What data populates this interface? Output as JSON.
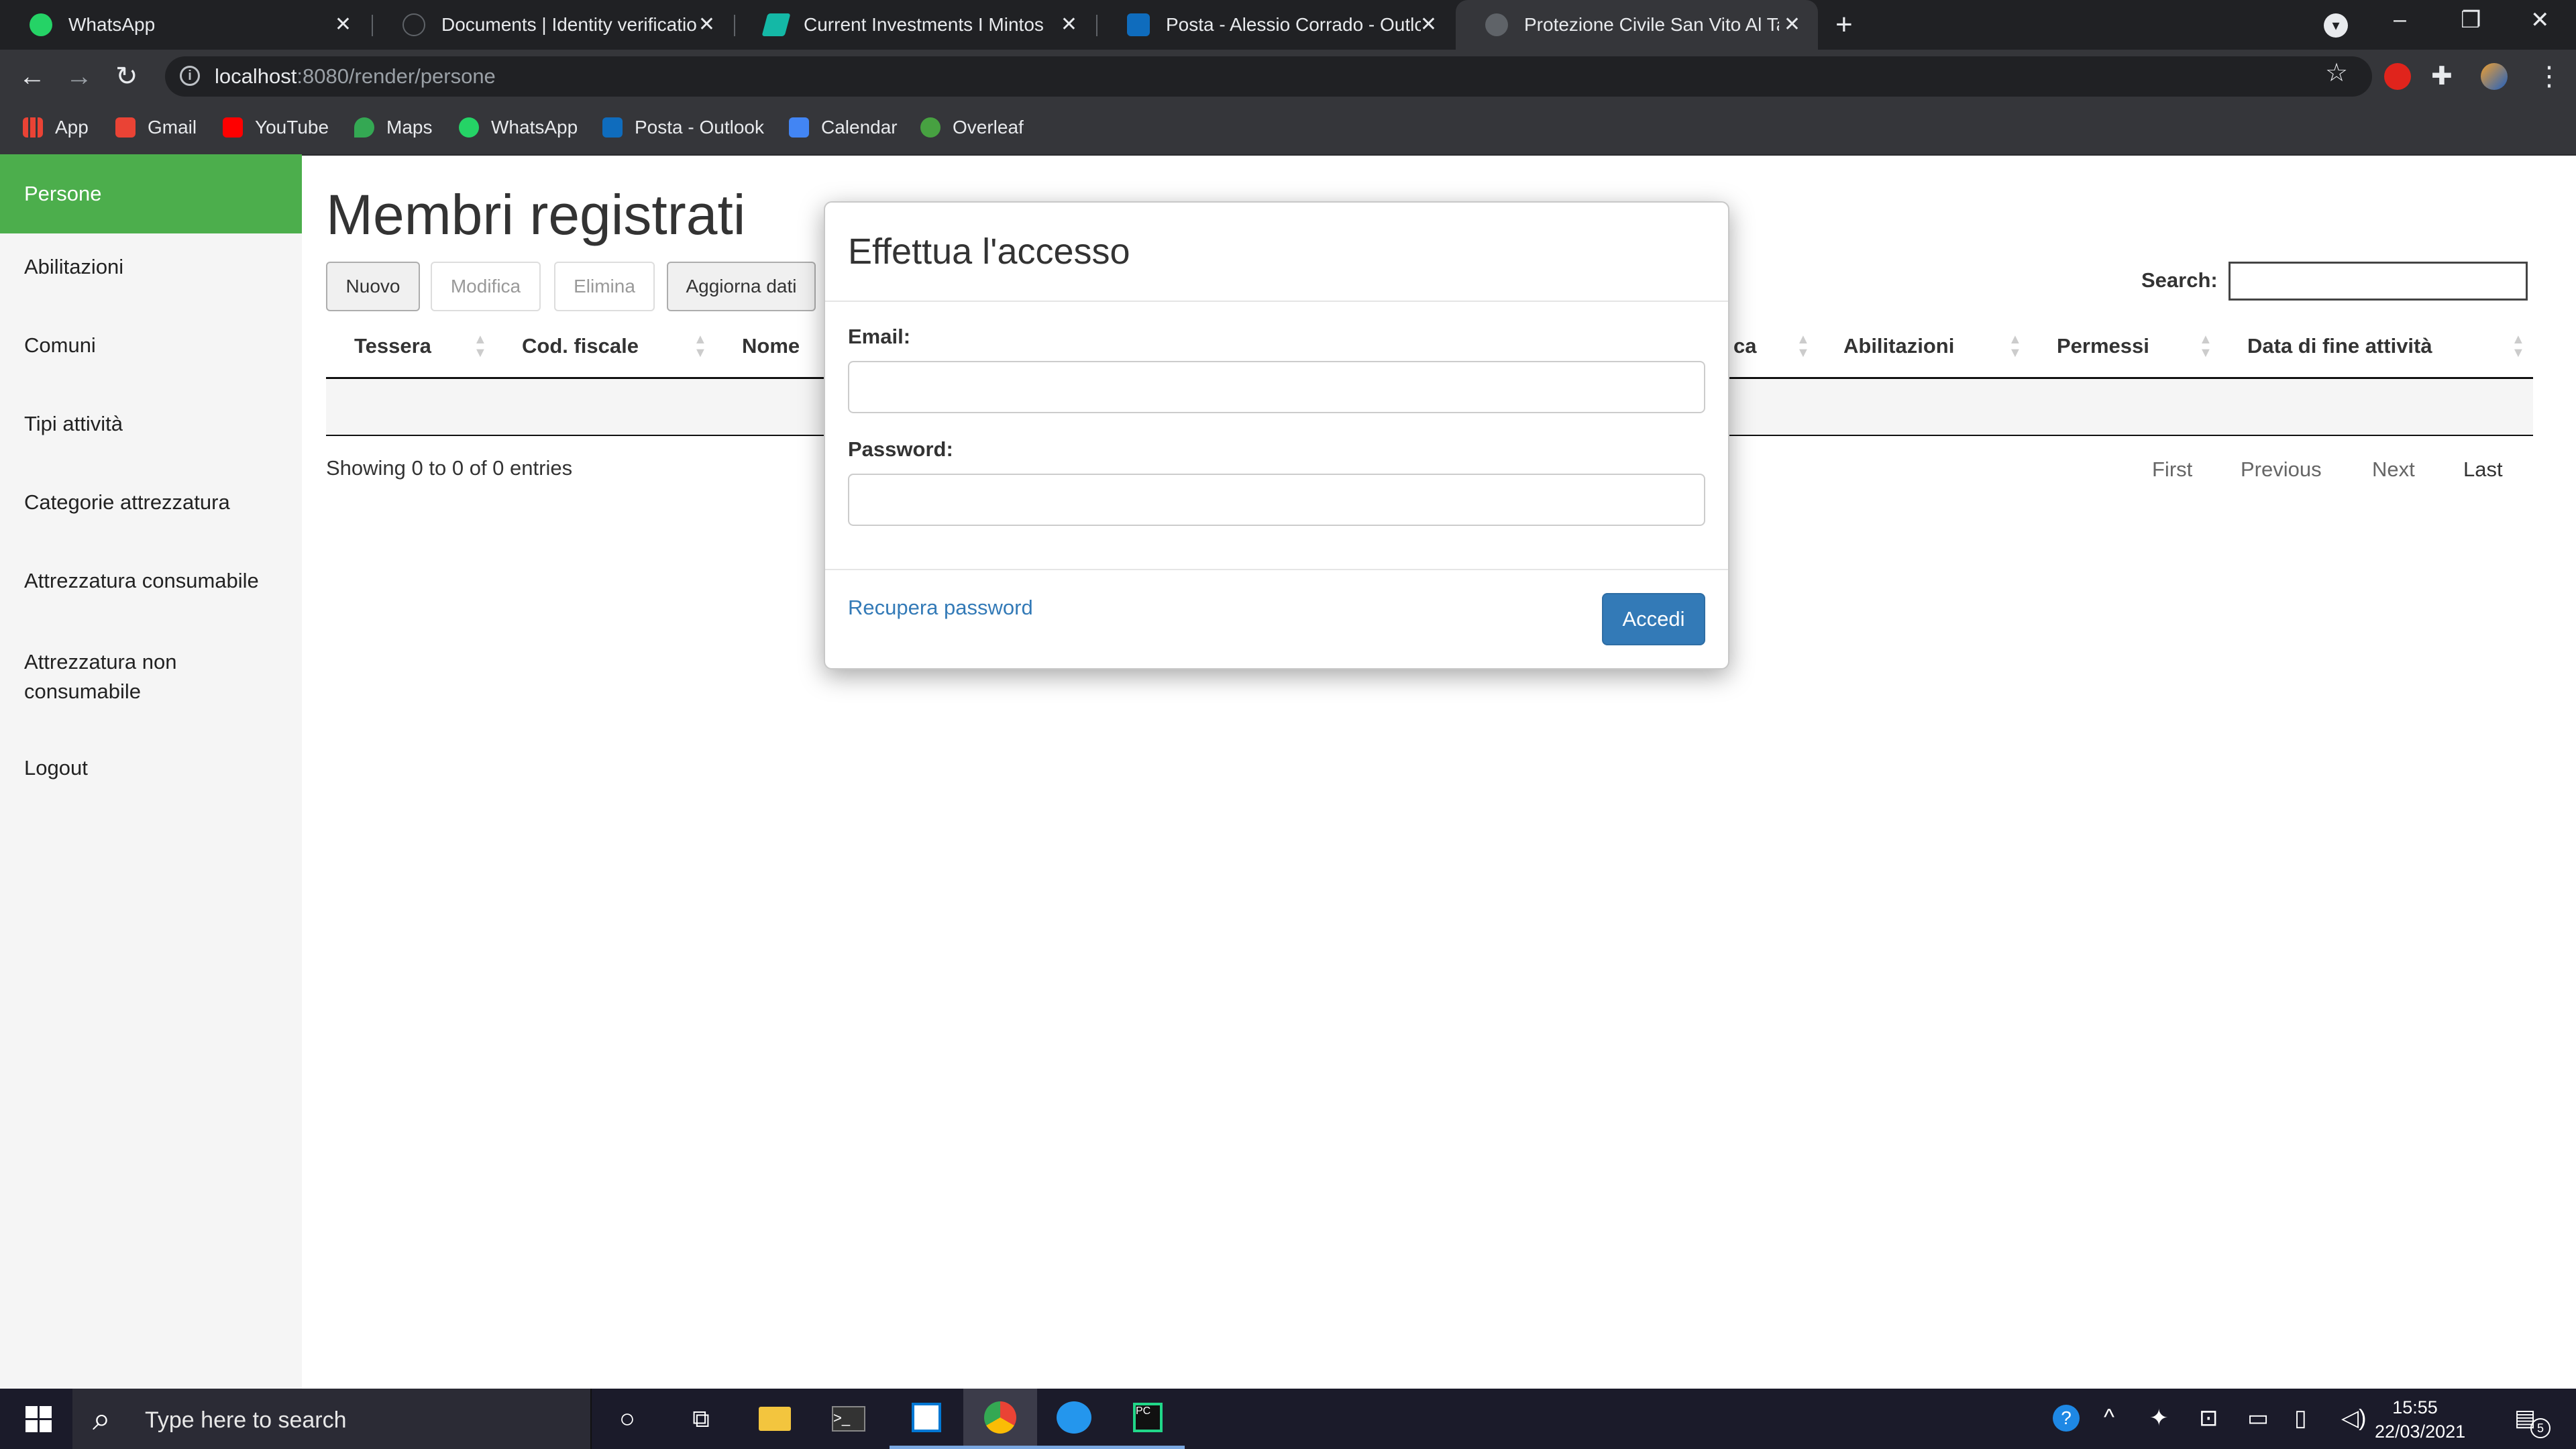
{
  "browser": {
    "tabs": [
      {
        "title": "WhatsApp",
        "icon": "whatsapp-icon",
        "color": "#25d366"
      },
      {
        "title": "Documents | Identity verification",
        "icon": "identity-site-icon",
        "color": "#5f6368"
      },
      {
        "title": "Current Investments I Mintos",
        "icon": "mintos-icon",
        "color": "#14b8a6"
      },
      {
        "title": "Posta - Alessio Corrado - Outlook",
        "icon": "outlook-icon",
        "color": "#0f6cbd"
      },
      {
        "title": "Protezione Civile San Vito Al Tagliamento",
        "icon": "globe-icon",
        "color": "#5f6368"
      }
    ],
    "url_host": "localhost",
    "url_rest": ":8080/render/persone",
    "bookmarks": [
      {
        "label": "App",
        "icon": "apps-grid-icon"
      },
      {
        "label": "Gmail",
        "icon": "gmail-icon"
      },
      {
        "label": "YouTube",
        "icon": "youtube-icon"
      },
      {
        "label": "Maps",
        "icon": "maps-icon"
      },
      {
        "label": "WhatsApp",
        "icon": "whatsapp-icon"
      },
      {
        "label": "Posta - Outlook",
        "icon": "outlook-icon"
      },
      {
        "label": "Calendar",
        "icon": "calendar-icon"
      },
      {
        "label": "Overleaf",
        "icon": "overleaf-icon"
      }
    ]
  },
  "sidebar": {
    "items": [
      {
        "label": "Persone",
        "active": true
      },
      {
        "label": "Abilitazioni"
      },
      {
        "label": "Comuni"
      },
      {
        "label": "Tipi attività"
      },
      {
        "label": "Categorie attrezzatura"
      },
      {
        "label": "Attrezzatura consumabile"
      },
      {
        "label": "Attrezzatura non consumabile"
      },
      {
        "label": "Logout"
      }
    ],
    "active_color": "#4cae4c"
  },
  "main": {
    "title": "Membri registrati",
    "buttons": {
      "new": "Nuovo",
      "edit": "Modifica",
      "delete": "Elimina",
      "refresh": "Aggiorna dati"
    },
    "search_label": "Search:",
    "search_value": "",
    "columns": [
      "Tessera",
      "Cod. fiscale",
      "Nome",
      "ca",
      "Abilitazioni",
      "Permessi",
      "Data di fine attività"
    ],
    "info": "Showing 0 to 0 of 0 entries",
    "pagination": {
      "first": "First",
      "previous": "Previous",
      "next": "Next",
      "last": "Last"
    }
  },
  "modal": {
    "title": "Effettua l'accesso",
    "email_label": "Email:",
    "email_value": "",
    "password_label": "Password:",
    "password_value": "",
    "recover_link": "Recupera password",
    "submit": "Accedi",
    "submit_color": "#337ab7"
  },
  "taskbar": {
    "search_placeholder": "Type here to search",
    "time": "15:55",
    "date": "22/03/2021",
    "notification_count": "5"
  }
}
